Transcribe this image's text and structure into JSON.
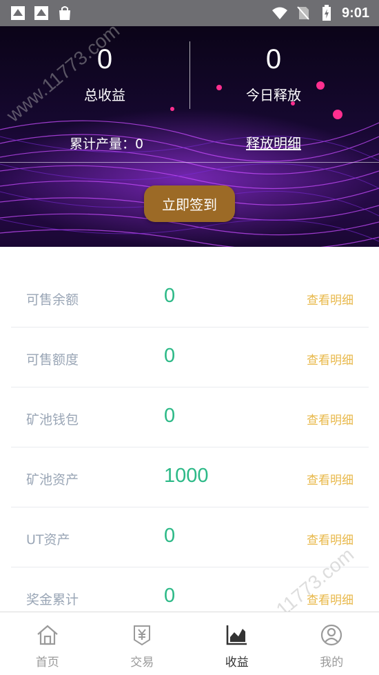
{
  "status_bar": {
    "time": "9:01"
  },
  "hero": {
    "total_income_value": "0",
    "total_income_label": "总收益",
    "today_release_value": "0",
    "today_release_label": "今日释放",
    "cumulative_output": "累计产量：0",
    "release_detail_link": "释放明细",
    "signin_button": "立即签到"
  },
  "balances": [
    {
      "label": "可售余额",
      "value": "0",
      "link": "查看明细"
    },
    {
      "label": "可售额度",
      "value": "0",
      "link": "查看明细"
    },
    {
      "label": "矿池钱包",
      "value": "0",
      "link": "查看明细"
    },
    {
      "label": "矿池资产",
      "value": "1000",
      "link": "查看明细"
    },
    {
      "label": "UT资产",
      "value": "0",
      "link": "查看明细"
    },
    {
      "label": "奖金累计",
      "value": "0",
      "link": "查看明细"
    }
  ],
  "bottom_nav": [
    {
      "label": "首页",
      "icon": "home-icon"
    },
    {
      "label": "交易",
      "icon": "yen-wallet-icon"
    },
    {
      "label": "收益",
      "icon": "chart-icon",
      "active": true
    },
    {
      "label": "我的",
      "icon": "user-icon"
    }
  ],
  "watermark": "www.11773.com",
  "colors": {
    "value_green": "#2cb987",
    "link_gold": "#e8b84a",
    "signin_bg": "#9c6a26",
    "label_gray": "#9aa6b6"
  }
}
